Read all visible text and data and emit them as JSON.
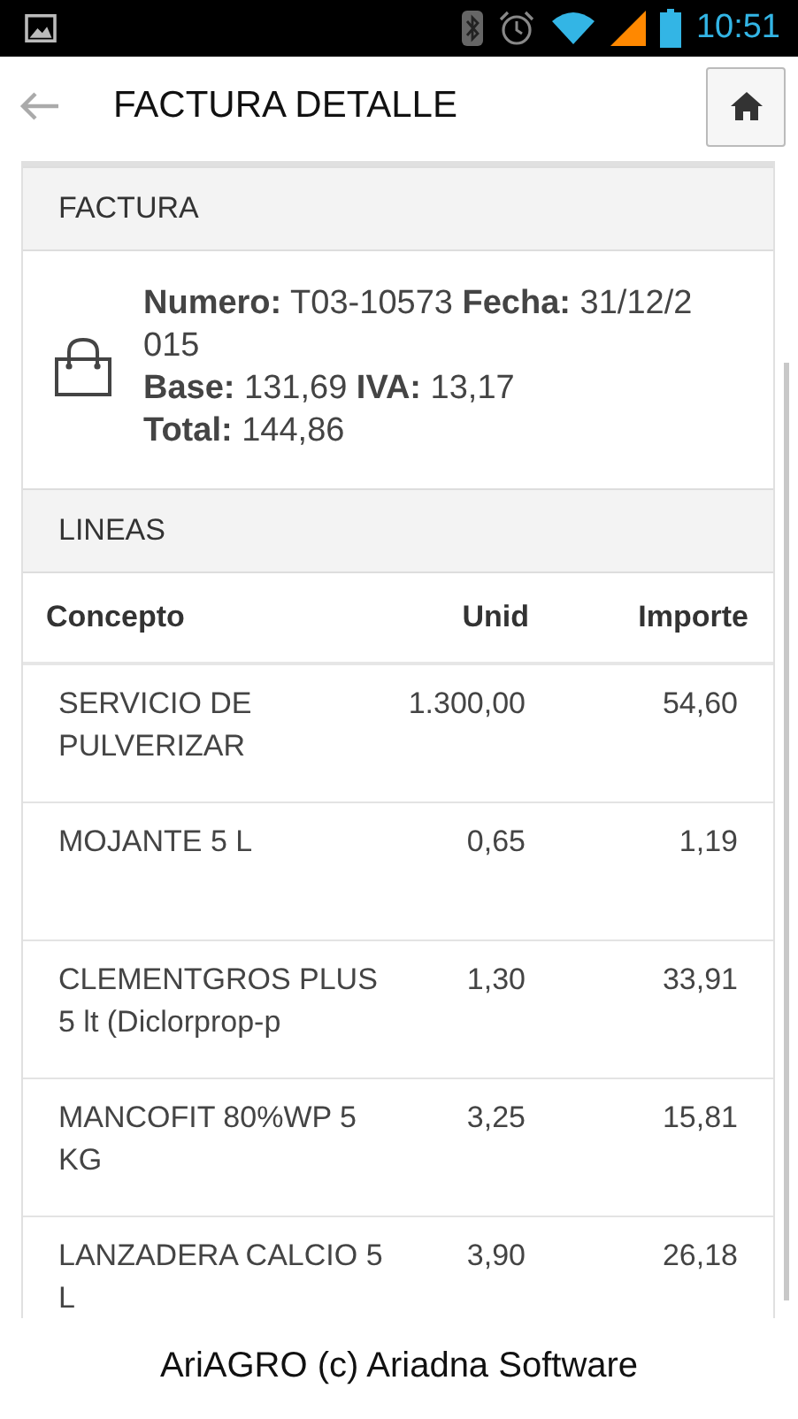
{
  "status_bar": {
    "time": "10:51"
  },
  "header": {
    "title": "FACTURA DETALLE"
  },
  "factura": {
    "section_title": "FACTURA",
    "lines": [
      "**Numero:** T03-10573 **Fecha:** 31/12/2015",
      "**Base:** 131,69 **IVA:** 13,17",
      "**Total:** 144,86"
    ]
  },
  "lineas": {
    "section_title": "LINEAS",
    "columns": [
      "Concepto",
      "Unid",
      "Importe"
    ],
    "rows": [
      {
        "concepto": "SERVICIO DE PULVERIZAR",
        "unid": "1.300,00",
        "importe": "54,60"
      },
      {
        "concepto": "MOJANTE 5 L",
        "unid": "0,65",
        "importe": "1,19"
      },
      {
        "concepto": "CLEMENTGROS PLUS 5 lt (Diclorprop-p",
        "unid": "1,30",
        "importe": "33,91"
      },
      {
        "concepto": "MANCOFIT 80%WP 5 KG",
        "unid": "3,25",
        "importe": "15,81"
      },
      {
        "concepto": "LANZADERA CALCIO 5 L",
        "unid": "3,90",
        "importe": "26,18"
      }
    ]
  },
  "footer": "AriAGRO (c) Ariadna Software"
}
